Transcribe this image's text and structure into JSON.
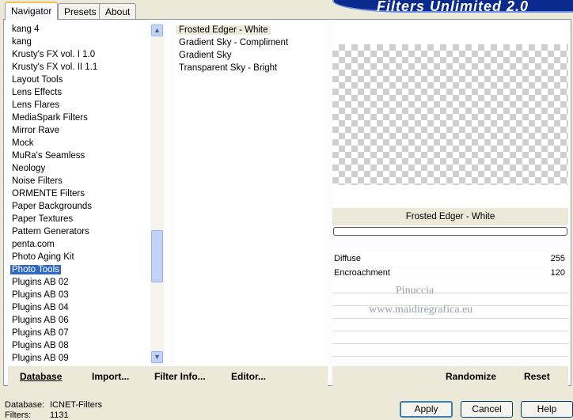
{
  "tabs": [
    {
      "label": "Navigator",
      "active": true
    },
    {
      "label": "Presets",
      "active": false
    },
    {
      "label": "About",
      "active": false
    }
  ],
  "banner_title": "Filters Unlimited 2.0",
  "categories": [
    "kang 4",
    "kang",
    "Krusty's FX vol. I 1.0",
    "Krusty's FX vol. II 1.1",
    "Layout Tools",
    "Lens Effects",
    "Lens Flares",
    "MediaSpark Filters",
    "Mirror Rave",
    "Mock",
    "MuRa's Seamless",
    "Neology",
    "Noise Filters",
    "ORMENTE Filters",
    "Paper Backgrounds",
    "Paper Textures",
    "Pattern Generators",
    "penta.com",
    "Photo Aging Kit",
    "Photo Tools",
    "Plugins AB 02",
    "Plugins AB 03",
    "Plugins AB 04",
    "Plugins AB 06",
    "Plugins AB 07",
    "Plugins AB 08",
    "Plugins AB 09"
  ],
  "selected_category": "Photo Tools",
  "filters": [
    "Frosted Edger - White",
    "Gradient Sky - Compliment",
    "Gradient Sky",
    "Transparent Sky - Bright"
  ],
  "selected_filter": "Frosted Edger - White",
  "preview_filter_name": "Frosted Edger - White",
  "params": [
    {
      "name": "Diffuse",
      "value": "255"
    },
    {
      "name": "Encroachment",
      "value": "120"
    }
  ],
  "watermark": {
    "line1": "Pinuccia",
    "line2": "www.maidiregrafica.eu"
  },
  "left_actions": {
    "database": "Database",
    "import": "Import...",
    "filter_info": "Filter Info...",
    "editor": "Editor..."
  },
  "right_actions": {
    "randomize": "Randomize",
    "reset": "Reset"
  },
  "status": {
    "database_label": "Database:",
    "database_value": "ICNET-Filters",
    "filters_label": "Filters:",
    "filters_value": "1131"
  },
  "buttons": {
    "apply": "Apply",
    "cancel": "Cancel",
    "help": "Help"
  },
  "colors": {
    "selection": "#316ac5",
    "banner": "#0a2a8e",
    "dialog_bg": "#ece9d8"
  }
}
